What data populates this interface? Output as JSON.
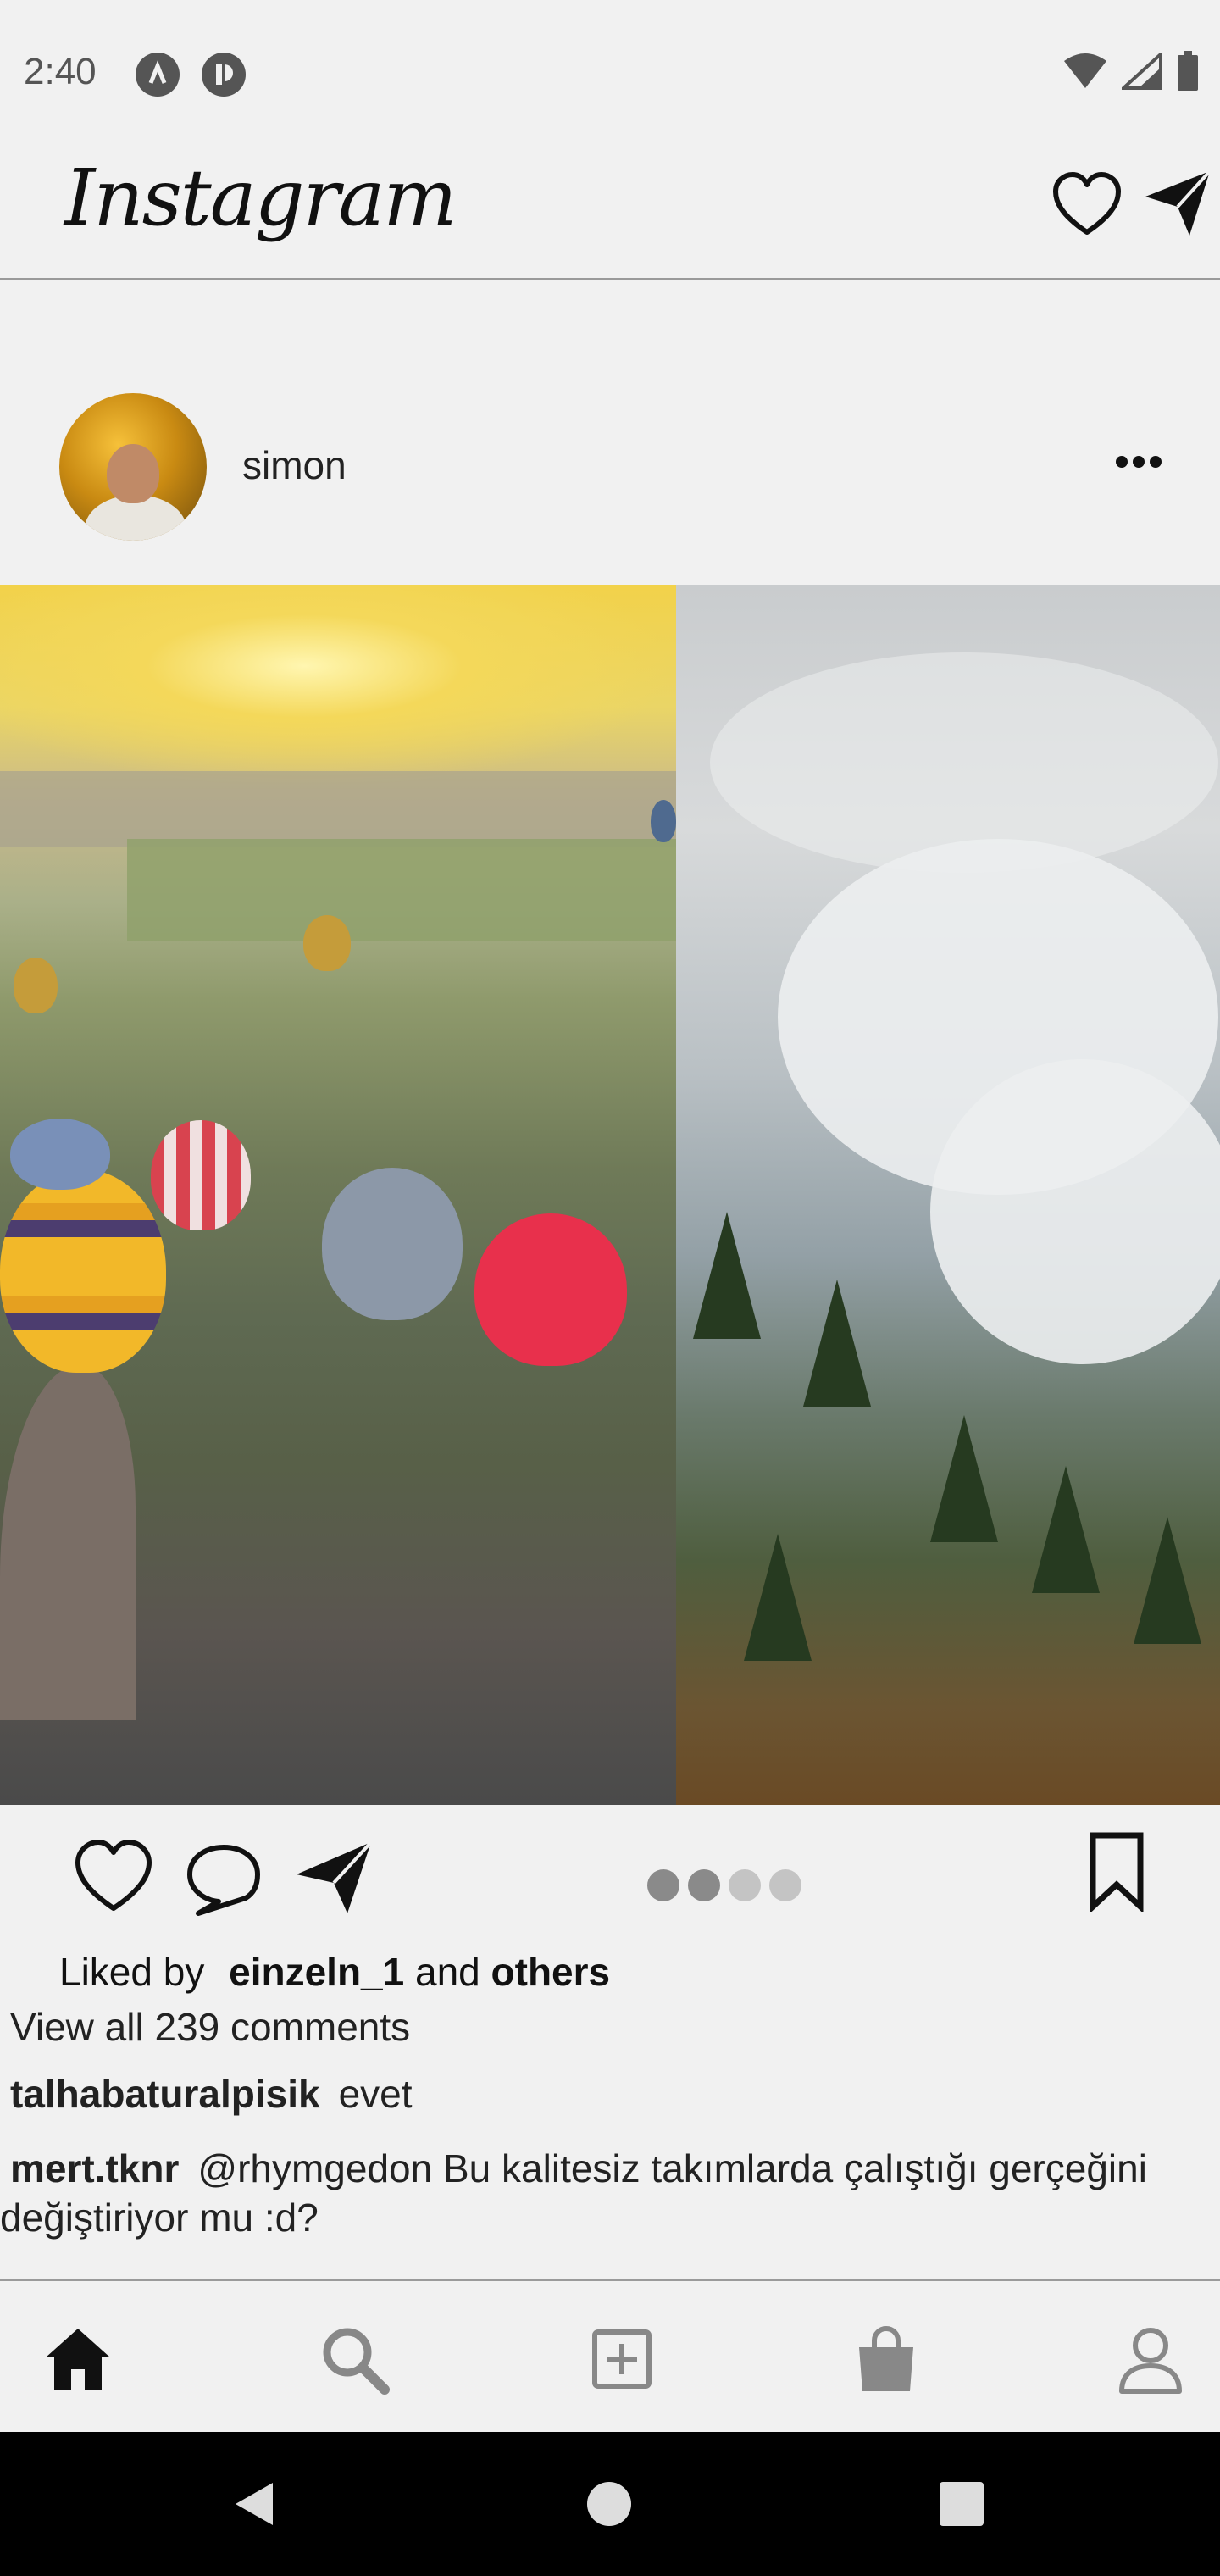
{
  "status_bar": {
    "time": "2:40",
    "left_icons": [
      "android-dev-icon",
      "app-icon"
    ],
    "right_icons": [
      "wifi-icon",
      "signal-icon",
      "battery-icon"
    ]
  },
  "header": {
    "logo": "Instagram",
    "icons": [
      "heart-icon",
      "send-icon"
    ]
  },
  "post": {
    "username": "simon",
    "menu_icon": "more-icon",
    "carousel": {
      "photos": [
        "hot air balloons over Cappadocia",
        "foggy forest mountain"
      ],
      "dots_count": 4,
      "active_dot": 1
    },
    "actions": [
      "like-icon",
      "comment-icon",
      "share-icon",
      "bookmark-icon"
    ],
    "likes": {
      "prefix": "Liked by",
      "user": "einzeln_1",
      "and": "and",
      "others": "others"
    },
    "view_all_comments": "View all 239 comments",
    "comments": [
      {
        "user": "talhabaturalpisik",
        "text": "evet"
      },
      {
        "user": "mert.tknr",
        "text": "@rhymgedon Bu kalitesiz takımlarda çalıştığı gerçeğini değiştiriyor mu :d?"
      }
    ]
  },
  "bottom_nav": {
    "items": [
      "home-icon",
      "search-icon",
      "add-icon",
      "shop-icon",
      "profile-icon"
    ],
    "active": "home-icon"
  },
  "colors": {
    "background": "#f1f1f1",
    "text": "#111111",
    "divider": "#9a9a9a",
    "dot_active": "#8a8a8a",
    "dot_inactive": "#c4c4c4"
  }
}
